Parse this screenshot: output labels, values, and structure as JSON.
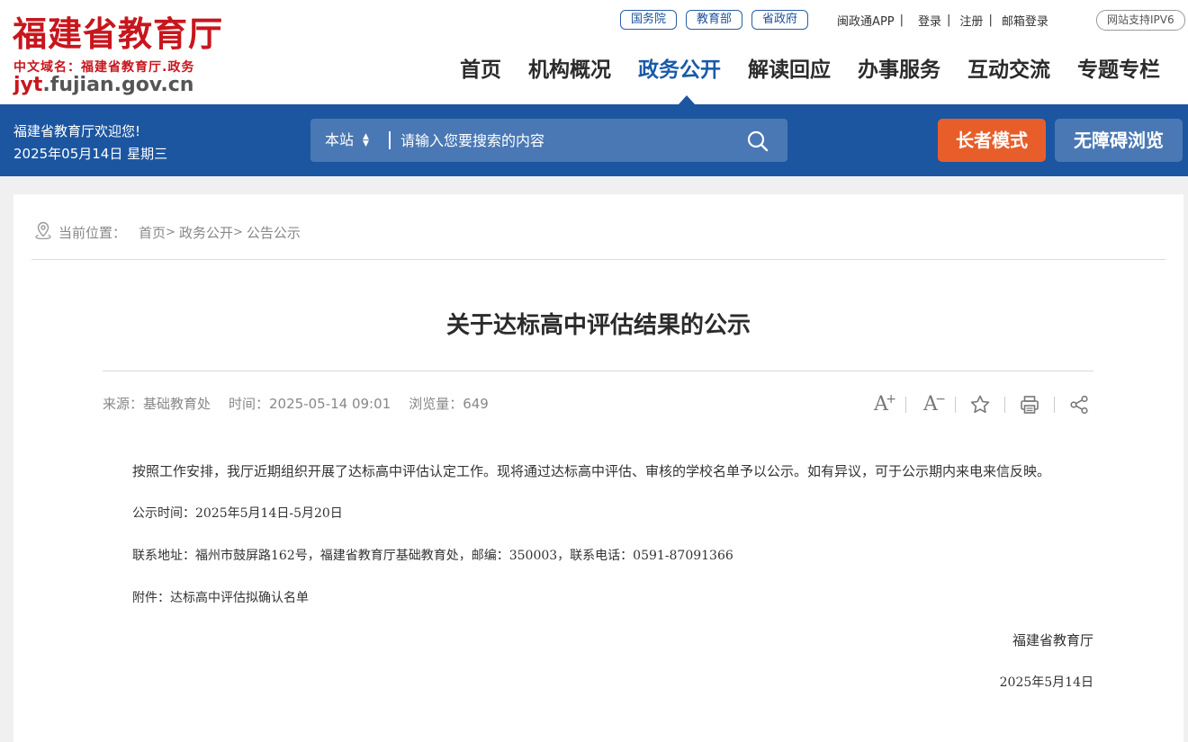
{
  "site": {
    "name": "福建省教育厅",
    "subtitle": "中文域名：福建省教育厅.政务",
    "domain_prefix": "jyt",
    "domain_rest": ".fujian.gov.cn"
  },
  "top_links": {
    "pills": [
      "国务院",
      "教育部",
      "省政府"
    ],
    "links": [
      "闽政通APP",
      "登录",
      "注册",
      "邮箱登录"
    ],
    "ipv6": "网站支持IPV6"
  },
  "nav": {
    "items": [
      "首页",
      "机构概况",
      "政务公开",
      "解读回应",
      "办事服务",
      "互动交流",
      "专题专栏"
    ],
    "active": "政务公开"
  },
  "welcome": {
    "line1": "福建省教育厅欢迎您!",
    "line2": "2025年05月14日 星期三"
  },
  "search": {
    "scope": "本站",
    "placeholder": "请输入您要搜索的内容",
    "icon": "search-icon"
  },
  "mode_buttons": {
    "elder": "长者模式",
    "accessible": "无障碍浏览"
  },
  "breadcrumb": {
    "label": "当前位置：",
    "items": [
      "首页",
      "政务公开",
      "公告公示"
    ],
    "separator": ">"
  },
  "article": {
    "title": "关于达标高中评估结果的公示",
    "meta": {
      "source": "来源：基础教育处",
      "time": "时间：2025-05-14 09:01",
      "views": "浏览量：649"
    },
    "tools": {
      "font_larger": "A",
      "font_smaller": "A"
    },
    "paragraphs": [
      "按照工作安排，我厅近期组织开展了达标高中评估认定工作。现将通过达标高中评估、审核的学校名单予以公示。如有异议，可于公示期内来电来信反映。",
      "公示时间：2025年5月14日-5月20日",
      "联系地址：福州市鼓屏路162号，福建省教育厅基础教育处，邮编：350003，联系电话：0591-87091366",
      "附件：达标高中评估拟确认名单"
    ],
    "signature": "福建省教育厅",
    "date": "2025年5月14日"
  },
  "colors": {
    "brand_red": "#c8161d",
    "nav_blue": "#1c56a0",
    "search_blue": "#4978b4",
    "elder_orange": "#e85e2a"
  }
}
